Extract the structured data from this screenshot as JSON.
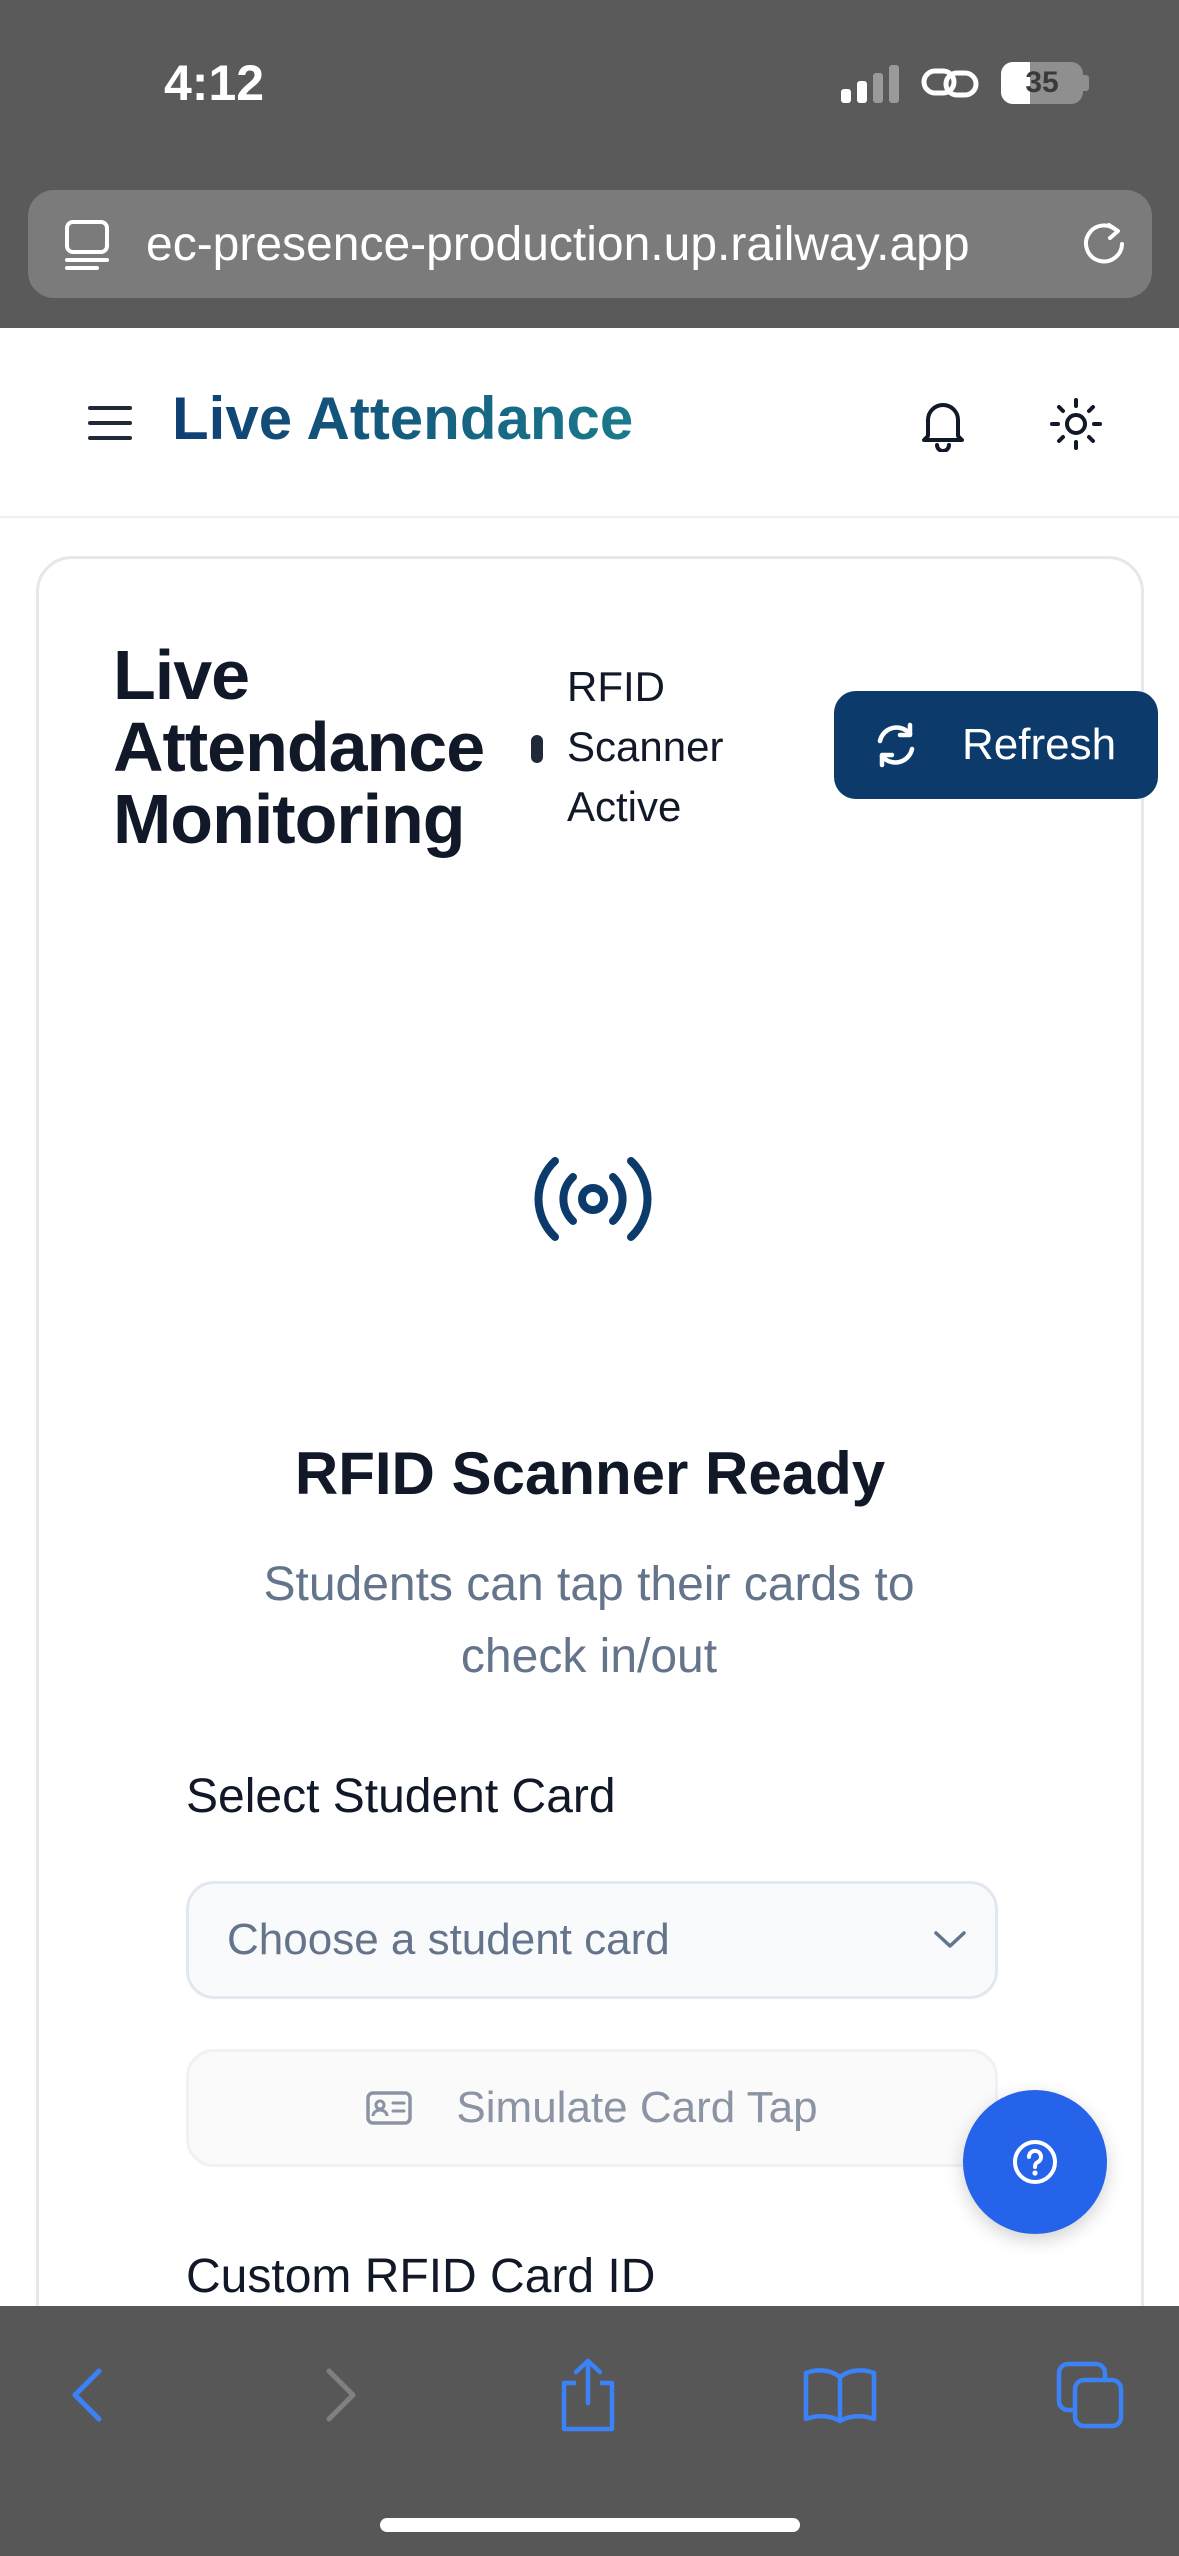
{
  "status_bar": {
    "time": "4:12",
    "battery": "35"
  },
  "browser": {
    "url": "ec-presence-production.up.railway.app"
  },
  "header": {
    "title": "Live Attendance"
  },
  "card": {
    "title_line1": "Live",
    "title_line2": "Attendance",
    "title_line3": "Monitoring",
    "status_line1": "RFID",
    "status_line2": "Scanner",
    "status_line3": "Active",
    "refresh_label": "Refresh"
  },
  "scanner": {
    "title": "RFID Scanner Ready",
    "subtitle": "Students can tap their cards to check in/out"
  },
  "form": {
    "select_label": "Select Student Card",
    "select_placeholder": "Choose a student card",
    "simulate_label": "Simulate Card Tap",
    "custom_label": "Custom RFID Card ID"
  },
  "colors": {
    "primary": "#0b3a6b",
    "fab": "#2563eb",
    "accent_link": "#3b82f6"
  }
}
